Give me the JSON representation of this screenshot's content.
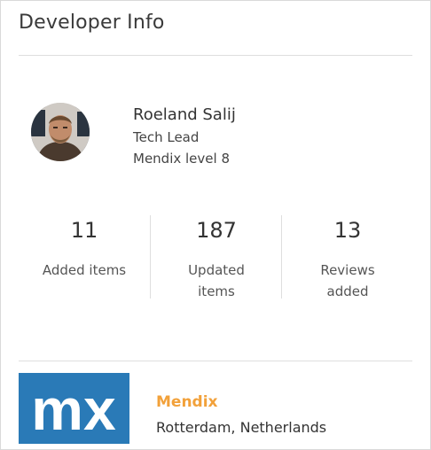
{
  "panel": {
    "title": "Developer Info"
  },
  "developer": {
    "name": "Roeland Salij",
    "role": "Tech Lead",
    "level": "Mendix level 8",
    "avatar_icon": "profile-photo"
  },
  "stats": [
    {
      "value": "11",
      "label": "Added items"
    },
    {
      "value": "187",
      "label": "Updated items"
    },
    {
      "value": "13",
      "label": "Reviews added"
    }
  ],
  "company": {
    "name": "Mendix",
    "location": "Rotterdam, Netherlands",
    "logo_text": "mx",
    "logo_color": "#2a7ab7",
    "name_color": "#f2a13a"
  }
}
